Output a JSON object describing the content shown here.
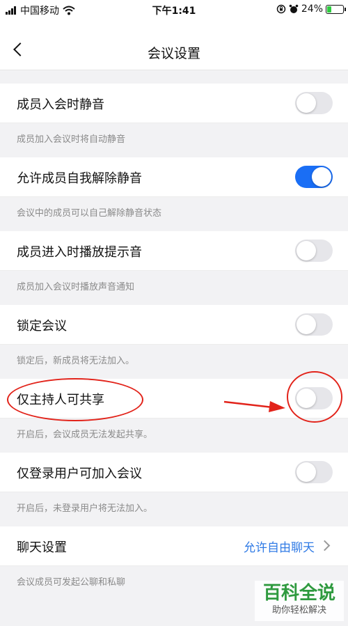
{
  "status_bar": {
    "carrier": "中国移动",
    "time": "下午1:41",
    "battery": "24%",
    "icons": [
      "signal-icon",
      "wifi-icon",
      "orientation-lock-icon",
      "alarm-icon",
      "battery-icon"
    ]
  },
  "nav": {
    "title": "会议设置",
    "back_icon": "chevron-left-icon"
  },
  "settings": [
    {
      "label": "成员入会时静音",
      "on": false,
      "description": "成员加入会议时将自动静音"
    },
    {
      "label": "允许成员自我解除静音",
      "on": true,
      "description": "会议中的成员可以自己解除静音状态"
    },
    {
      "label": "成员进入时播放提示音",
      "on": false,
      "description": "成员加入会议时播放声音通知"
    },
    {
      "label": "锁定会议",
      "on": false,
      "description": "锁定后，新成员将无法加入。"
    },
    {
      "label": "仅主持人可共享",
      "on": false,
      "description": "开启后，会议成员无法发起共享。"
    },
    {
      "label": "仅登录用户可加入会议",
      "on": false,
      "description": "开启后，未登录用户将无法加入。"
    }
  ],
  "chat": {
    "label": "聊天设置",
    "value": "允许自由聊天",
    "description": "会议成员可发起公聊和私聊"
  },
  "watermark": {
    "main": "百科全说",
    "sub": "助你轻松解决"
  },
  "colors": {
    "toggle_on": "#1a6ef5",
    "toggle_off": "#e6e6ea",
    "link": "#2f7ae5",
    "annotation": "#e2231a",
    "background": "#f2f2f4"
  }
}
